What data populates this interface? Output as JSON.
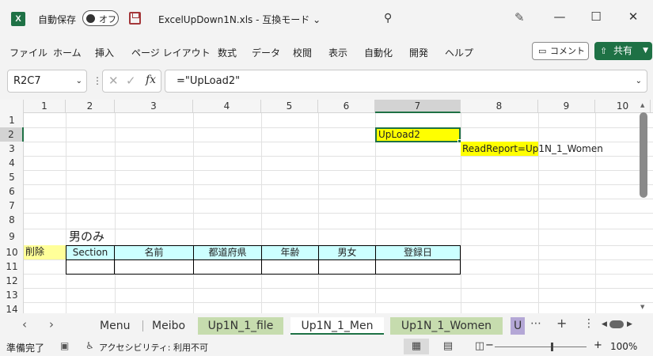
{
  "titlebar": {
    "autosave_label": "自動保存",
    "autosave_state": "オフ",
    "doc_title": "ExcelUpDown1N.xls  -  互換モード ⌄",
    "minimize": "—",
    "maximize": "☐",
    "close": "✕"
  },
  "menu": {
    "items": [
      "ファイル",
      "ホーム",
      "挿入",
      "ページ レイアウト",
      "数式",
      "データ",
      "校閲",
      "表示",
      "自動化",
      "開発",
      "ヘルプ"
    ],
    "comment_label": "コメント",
    "share_label": "共有"
  },
  "formula_bar": {
    "name_box": "R2C7",
    "formula": "=\"UpLoad2\""
  },
  "grid": {
    "columns": [
      "1",
      "2",
      "3",
      "4",
      "5",
      "6",
      "7",
      "8",
      "9",
      "10"
    ],
    "selected_column": "7",
    "rows": [
      "1",
      "2",
      "3",
      "4",
      "5",
      "6",
      "7",
      "8",
      "9",
      "10",
      "11",
      "12",
      "13",
      "14"
    ],
    "selected_row": "2",
    "cells": {
      "r2c7": "UpLoad2",
      "r3c8": "ReadReport=Up1N_1_Women",
      "r9c2": "男のみ",
      "r10c1": "削除",
      "r10c2": "Section",
      "r10c3": "名前",
      "r10c4": "都道府県",
      "r10c5": "年齢",
      "r10c6": "男女",
      "r10c7": "登録日"
    }
  },
  "sheet_tabs": {
    "tabs": [
      "Menu",
      "Meibo",
      "Up1N_1_file",
      "Up1N_1_Men",
      "Up1N_1_Women",
      "U"
    ],
    "active": "Up1N_1_Men"
  },
  "status": {
    "ready": "準備完了",
    "accessibility": "アクセシビリティ: 利用不可",
    "zoom": "100%"
  },
  "colors": {
    "excel_green": "#1e7145",
    "yellow_fill": "#ffff00",
    "light_yellow_fill": "#ffff99",
    "cyan_fill": "#ccffff",
    "tab_green": "#c6dcae",
    "tab_purple": "#b4a7d6"
  }
}
